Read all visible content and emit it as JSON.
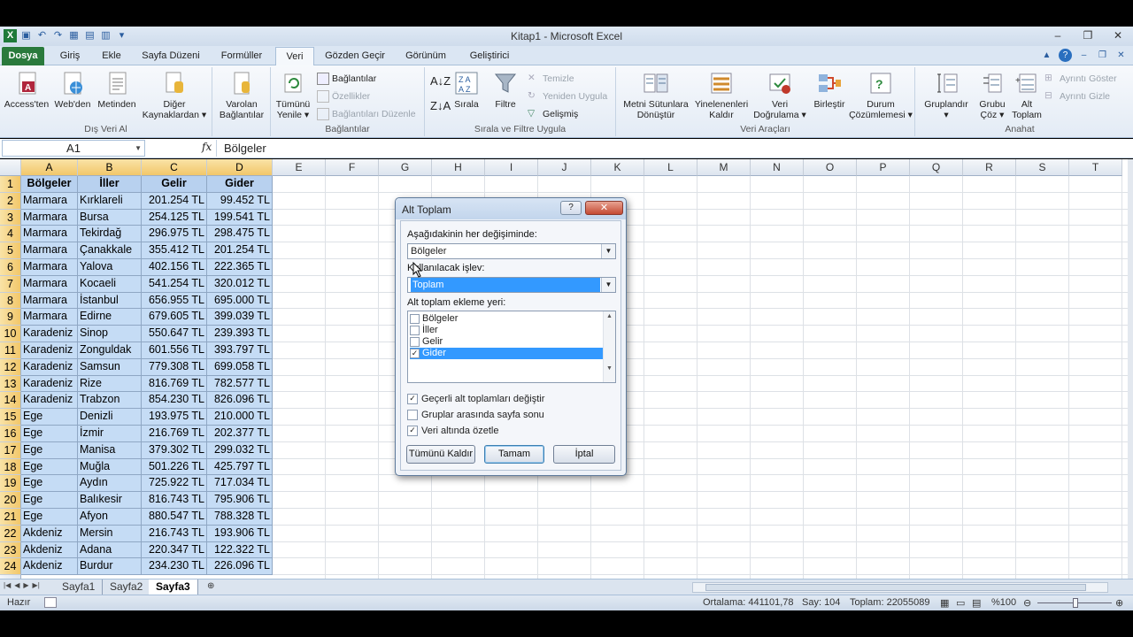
{
  "window": {
    "title": "Kitap1 - Microsoft Excel"
  },
  "tabs": [
    {
      "label": "Dosya"
    },
    {
      "label": "Giriş"
    },
    {
      "label": "Ekle"
    },
    {
      "label": "Sayfa Düzeni"
    },
    {
      "label": "Formüller"
    },
    {
      "label": "Veri"
    },
    {
      "label": "Gözden Geçir"
    },
    {
      "label": "Görünüm"
    },
    {
      "label": "Geliştirici"
    }
  ],
  "ribbon": {
    "groups": {
      "dis_veri": "Dış Veri Al",
      "baglantilar": "Bağlantılar",
      "sirala": "Sırala ve Filtre Uygula",
      "veri_araclari": "Veri Araçları",
      "anahat": "Anahat"
    },
    "access": "Access'ten",
    "web": "Web'den",
    "metin": "Metinden",
    "diger1": "Diğer",
    "diger2": "Kaynaklardan",
    "varolan1": "Varolan",
    "varolan2": "Bağlantılar",
    "tumunu1": "Tümünü",
    "tumunu2": "Yenile",
    "baglantilar_btn": "Bağlantılar",
    "ozellikler": "Özellikler",
    "baglantilari_duzenle": "Bağlantıları Düzenle",
    "sirala_btn": "Sırala",
    "filtre": "Filtre",
    "temizle": "Temizle",
    "yeniden": "Yeniden Uygula",
    "gelismis": "Gelişmiş",
    "metni1": "Metni Sütunlara",
    "metni2": "Dönüştür",
    "yinelenen1": "Yinelenenleri",
    "yinelenen2": "Kaldır",
    "dogrulama1": "Veri",
    "dogrulama2": "Doğrulama",
    "birlestir": "Birleştir",
    "durum1": "Durum",
    "durum2": "Çözümlemesi",
    "grupla": "Gruplandır",
    "grubu1": "Grubu",
    "grubu2": "Çöz",
    "alt1": "Alt",
    "alt2": "Toplam",
    "ayrinti_goster": "Ayrıntı Göster",
    "ayrinti_gizle": "Ayrıntı Gizle"
  },
  "formula_bar": {
    "name_box": "A1",
    "fx": "fx",
    "content": "Bölgeler"
  },
  "columns": [
    "A",
    "B",
    "C",
    "D",
    "E",
    "F",
    "G",
    "H",
    "I",
    "J",
    "K",
    "L",
    "M",
    "N",
    "O",
    "P",
    "Q",
    "R",
    "S",
    "T"
  ],
  "rows": [
    [
      "Bölgeler",
      "İller",
      "Gelir",
      "Gider"
    ],
    [
      "Marmara",
      "Kırklareli",
      "201.254 TL",
      "99.452 TL"
    ],
    [
      "Marmara",
      "Bursa",
      "254.125 TL",
      "199.541 TL"
    ],
    [
      "Marmara",
      "Tekirdağ",
      "296.975 TL",
      "298.475 TL"
    ],
    [
      "Marmara",
      "Çanakkale",
      "355.412 TL",
      "201.254 TL"
    ],
    [
      "Marmara",
      "Yalova",
      "402.156 TL",
      "222.365 TL"
    ],
    [
      "Marmara",
      "Kocaeli",
      "541.254 TL",
      "320.012 TL"
    ],
    [
      "Marmara",
      "İstanbul",
      "656.955 TL",
      "695.000 TL"
    ],
    [
      "Marmara",
      "Edirne",
      "679.605 TL",
      "399.039 TL"
    ],
    [
      "Karadeniz",
      "Sinop",
      "550.647 TL",
      "239.393 TL"
    ],
    [
      "Karadeniz",
      "Zonguldak",
      "601.556 TL",
      "393.797 TL"
    ],
    [
      "Karadeniz",
      "Samsun",
      "779.308 TL",
      "699.058 TL"
    ],
    [
      "Karadeniz",
      "Rize",
      "816.769 TL",
      "782.577 TL"
    ],
    [
      "Karadeniz",
      "Trabzon",
      "854.230 TL",
      "826.096 TL"
    ],
    [
      "Ege",
      "Denizli",
      "193.975 TL",
      "210.000 TL"
    ],
    [
      "Ege",
      "İzmir",
      "216.769 TL",
      "202.377 TL"
    ],
    [
      "Ege",
      "Manisa",
      "379.302 TL",
      "299.032 TL"
    ],
    [
      "Ege",
      "Muğla",
      "501.226 TL",
      "425.797 TL"
    ],
    [
      "Ege",
      "Aydın",
      "725.922 TL",
      "717.034 TL"
    ],
    [
      "Ege",
      "Balıkesir",
      "816.743 TL",
      "795.906 TL"
    ],
    [
      "Ege",
      "Afyon",
      "880.547 TL",
      "788.328 TL"
    ],
    [
      "Akdeniz",
      "Mersin",
      "216.743 TL",
      "193.906 TL"
    ],
    [
      "Akdeniz",
      "Adana",
      "220.347 TL",
      "122.322 TL"
    ],
    [
      "Akdeniz",
      "Burdur",
      "234.230 TL",
      "226.096 TL"
    ]
  ],
  "sheets": [
    "Sayfa1",
    "Sayfa2",
    "Sayfa3"
  ],
  "status": {
    "ready": "Hazır",
    "average": "Ortalama: 441101,78",
    "count": "Say: 104",
    "sum": "Toplam: 22055089",
    "zoom": "%100"
  },
  "dialog": {
    "title": "Alt Toplam",
    "help": "?",
    "close": "✕",
    "each_change_label": "Aşağıdakinin her değişiminde:",
    "each_change_value": "Bölgeler",
    "function_label": "Kullanılacak işlev:",
    "function_value": "Toplam",
    "add_to_label": "Alt toplam ekleme yeri:",
    "add_to_items": [
      {
        "label": "Bölgeler",
        "checked": false
      },
      {
        "label": "İller",
        "checked": false
      },
      {
        "label": "Gelir",
        "checked": false
      },
      {
        "label": "Gider",
        "checked": true
      }
    ],
    "replace_current": "Geçerli alt toplamları değiştir",
    "page_break": "Gruplar arasında sayfa sonu",
    "summary_below": "Veri altında özetle",
    "remove_all": "Tümünü Kaldır",
    "ok": "Tamam",
    "cancel": "İptal"
  },
  "colors": {
    "file_tab": "#2a7a3c",
    "selection": "#c5dcf5",
    "highlight": "#3399ff"
  }
}
